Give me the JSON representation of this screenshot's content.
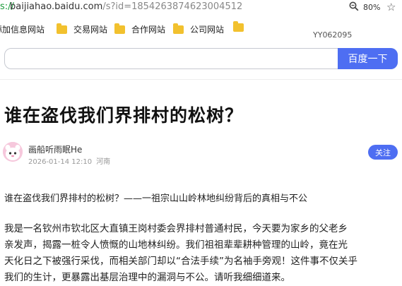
{
  "browser": {
    "url_scheme_fragment": "s://",
    "url_host": "baijiahao.baidu.com",
    "url_path": "/s?id=1854263874623004512",
    "zoom": "80%"
  },
  "bookmarks": [
    {
      "label": "添加信息网站",
      "show_folder": false
    },
    {
      "label": "交易网站",
      "show_folder": true
    },
    {
      "label": "合作网站",
      "show_folder": true
    },
    {
      "label": "公司网站",
      "show_folder": true
    },
    {
      "label": "",
      "show_folder": true
    }
  ],
  "watermark_code": "YY062095",
  "search": {
    "placeholder": "",
    "button_label": "百度一下"
  },
  "article": {
    "title": "谁在盗伐我们界排村的松树？",
    "author_name": "画船听雨眠He",
    "date": "2026-01-14 12:10",
    "location": "河南",
    "follow_label": "关注",
    "subtitle": "谁在盗伐我们界排村的松树？——一祖宗山山岭林地纠纷背后的真相与不公",
    "paragraph_lines": [
      "我是一名钦州市钦北区大直镇王岗村委会界排村普通村民，今天要为家乡的父老乡",
      "亲发声，揭露一桩令人愤慨的山地林纠纷。我们祖祖辈辈耕种管理的山岭，竟在光",
      "天化日之下被强行采伐，而相关部门却以“合法手续”为名袖手旁观！这件事不仅关乎",
      "我们的生计，更暴露出基层治理中的漏洞与不公。请听我细细道来。"
    ]
  },
  "colors": {
    "accent": "#4e6ef2",
    "folder": "#f2c12e",
    "scheme": "#1a9a3a"
  }
}
